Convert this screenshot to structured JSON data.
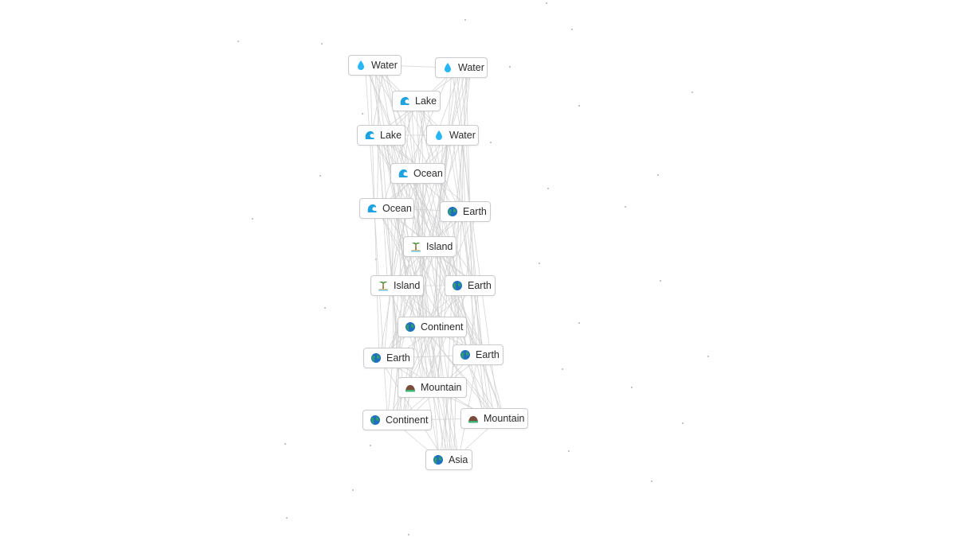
{
  "canvas": {
    "description": "Infinite Craft style crafting canvas",
    "colors": {
      "background": "#ffffff",
      "edge": "#cfcfcf",
      "node_border": "#c8ccd0",
      "text": "#2b2b2b",
      "water": "#29b6f6",
      "wave": "#1fa3e0",
      "earth_green": "#2e9e6b",
      "earth_blue": "#1e6fc0",
      "mountain_brown": "#7a4a3a",
      "mountain_green": "#3cb371"
    }
  },
  "nodes": [
    {
      "label": "Water",
      "icon": "water-drop-icon"
    },
    {
      "label": "Water",
      "icon": "water-drop-icon"
    },
    {
      "label": "Lake",
      "icon": "wave-icon"
    },
    {
      "label": "Lake",
      "icon": "wave-icon"
    },
    {
      "label": "Water",
      "icon": "water-drop-icon"
    },
    {
      "label": "Ocean",
      "icon": "wave-icon"
    },
    {
      "label": "Ocean",
      "icon": "wave-icon"
    },
    {
      "label": "Earth",
      "icon": "globe-icon"
    },
    {
      "label": "Island",
      "icon": "palm-island-icon"
    },
    {
      "label": "Island",
      "icon": "palm-island-icon"
    },
    {
      "label": "Earth",
      "icon": "globe-icon"
    },
    {
      "label": "Continent",
      "icon": "globe-icon"
    },
    {
      "label": "Earth",
      "icon": "globe-icon"
    },
    {
      "label": "Earth",
      "icon": "globe-icon"
    },
    {
      "label": "Mountain",
      "icon": "mountain-icon"
    },
    {
      "label": "Continent",
      "icon": "globe-icon"
    },
    {
      "label": "Mountain",
      "icon": "mountain-icon"
    },
    {
      "label": "Asia",
      "icon": "globe-icon"
    }
  ]
}
